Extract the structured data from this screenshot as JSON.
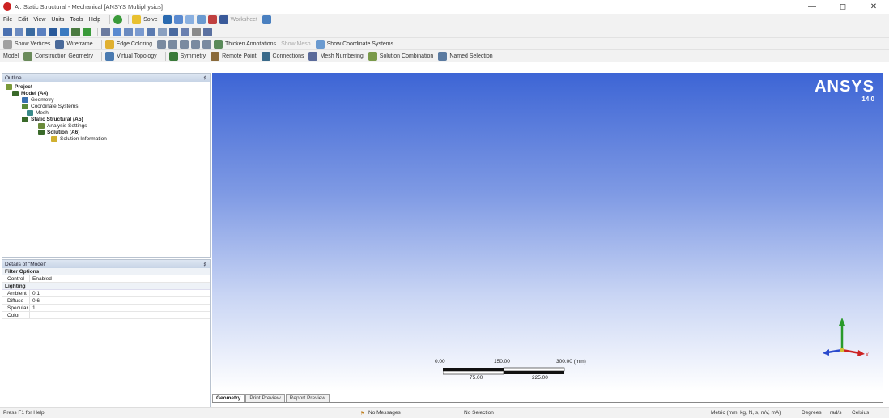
{
  "window": {
    "title": "A : Static Structural - Mechanical [ANSYS Multiphysics]",
    "controls": [
      "—",
      "◻",
      "✕"
    ]
  },
  "menu": [
    "File",
    "Edit",
    "View",
    "Units",
    "Tools",
    "Help"
  ],
  "toolbar1": {
    "solve_label": "Solve",
    "worksheet_label": "Worksheet"
  },
  "toolbar2": {},
  "toolbar3": {
    "show_vertices": "Show Vertices",
    "wireframe": "Wireframe",
    "edge_coloring": "Edge Coloring",
    "thicken": "Thicken Annotations",
    "show_mesh": "Show Mesh",
    "show_coord": "Show Coordinate Systems"
  },
  "toolbar4": {
    "model": "Model",
    "construction_geometry": "Construction Geometry",
    "virtual_topology": "Virtual Topology",
    "symmetry": "Symmetry",
    "remote_point": "Remote Point",
    "connections": "Connections",
    "mesh_numbering": "Mesh Numbering",
    "solution_combination": "Solution Combination",
    "named_selection": "Named Selection"
  },
  "outline": {
    "header": "Outline",
    "pin": "♯",
    "items": [
      {
        "label": "Project",
        "level": 0,
        "bold": true,
        "color": "#7a9a3a"
      },
      {
        "label": "Model (A4)",
        "level": 1,
        "bold": true,
        "color": "#3a6a2a"
      },
      {
        "label": "Geometry",
        "level": 2,
        "bold": false,
        "color": "#3a70b0"
      },
      {
        "label": "Coordinate Systems",
        "level": 2,
        "bold": false,
        "color": "#5a8a3a"
      },
      {
        "label": "Mesh",
        "level": 2,
        "bold": false,
        "color": "#3a8a8a"
      },
      {
        "label": "Static Structural (A5)",
        "level": 2,
        "bold": true,
        "color": "#3a6a2a"
      },
      {
        "label": "Analysis Settings",
        "level": 3,
        "bold": false,
        "color": "#6a8a3a"
      },
      {
        "label": "Solution (A6)",
        "level": 3,
        "bold": true,
        "color": "#3a6a2a"
      },
      {
        "label": "Solution Information",
        "level": 4,
        "bold": false,
        "color": "#d0b030"
      }
    ]
  },
  "details": {
    "header": "Details of \"Model\"",
    "pin": "♯",
    "groups": [
      {
        "name": "Filter Options",
        "rows": [
          {
            "key": "Control",
            "value": "Enabled"
          }
        ]
      },
      {
        "name": "Lighting",
        "rows": [
          {
            "key": "Ambient",
            "value": "0.1"
          },
          {
            "key": "Diffuse",
            "value": "0.6"
          },
          {
            "key": "Specular",
            "value": "1"
          },
          {
            "key": "Color",
            "value": ""
          }
        ]
      }
    ]
  },
  "viewport": {
    "logo": "ANSYS",
    "version": "14.0",
    "scale": {
      "top": [
        "0.00",
        "150.00",
        "300.00 (mm)"
      ],
      "bottom": [
        "75.00",
        "225.00"
      ]
    },
    "triad_axis_label": "X"
  },
  "bottom_tabs": [
    "Geometry",
    "Print Preview",
    "Report Preview"
  ],
  "status": {
    "help": "Press F1 for Help",
    "messages": "No Messages",
    "selection": "No Selection",
    "units": "Metric (mm, kg, N, s, mV, mA)",
    "degrees": "Degrees",
    "rads": "rad/s",
    "celsius": "Celsius"
  },
  "colors": {
    "viewport_top": "#3d65d5",
    "viewport_bottom": "#ffffff"
  }
}
